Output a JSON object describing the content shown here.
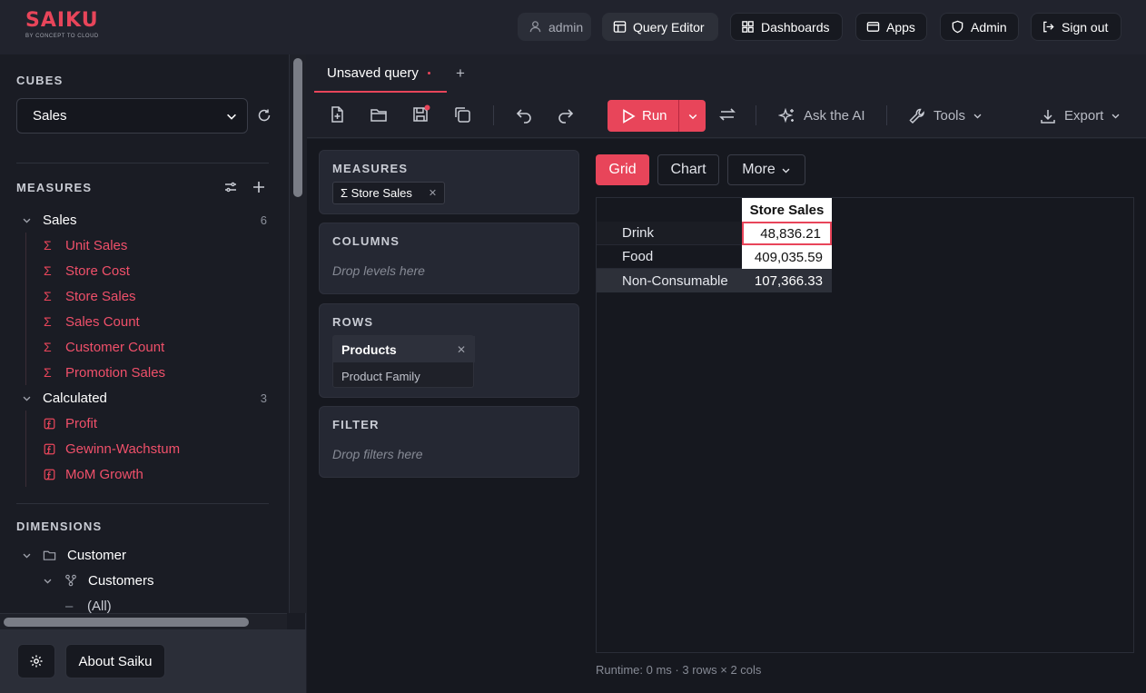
{
  "brand": {
    "logo": "SAIKU",
    "tagline": "BY CONCEPT TO CLOUD",
    "accent": "#e8455a"
  },
  "nav": {
    "user": "admin",
    "query_editor": "Query Editor",
    "dashboards": "Dashboards",
    "apps": "Apps",
    "admin": "Admin",
    "sign_out": "Sign out"
  },
  "sidebar": {
    "cubes_title": "CUBES",
    "cube_selected": "Sales",
    "measures_title": "MEASURES",
    "groups": [
      {
        "label": "Sales",
        "count": "6",
        "items": [
          "Unit Sales",
          "Store Cost",
          "Store Sales",
          "Sales Count",
          "Customer Count",
          "Promotion Sales"
        ]
      },
      {
        "label": "Calculated",
        "count": "3",
        "items": [
          "Profit",
          "Gewinn-Wachstum",
          "MoM Growth"
        ]
      }
    ],
    "dimensions_title": "DIMENSIONS",
    "dimensions": {
      "customer": "Customer",
      "customers": "Customers",
      "all": "(All)"
    },
    "about": "About Saiku"
  },
  "tabs": [
    {
      "label": "Unsaved query",
      "modified": true
    }
  ],
  "toolbar": {
    "run": "Run",
    "ask_ai": "Ask the AI",
    "tools": "Tools",
    "export": "Export"
  },
  "query": {
    "measures_title": "MEASURES",
    "measure_chip": "Σ Store Sales",
    "columns_title": "COLUMNS",
    "columns_hint": "Drop levels here",
    "rows_title": "ROWS",
    "row_dimension": "Products",
    "row_level": "Product Family",
    "filter_title": "FILTER",
    "filter_hint": "Drop filters here"
  },
  "view": {
    "grid": "Grid",
    "chart": "Chart",
    "more": "More"
  },
  "grid": {
    "column_header": "Store Sales",
    "rows": [
      {
        "label": "Drink",
        "value": "48,836.21",
        "selected": true
      },
      {
        "label": "Food",
        "value": "409,035.59",
        "selected": false
      },
      {
        "label": "Non-Consumable",
        "value": "107,366.33",
        "selected": false
      }
    ]
  },
  "status": {
    "runtime": "Runtime: 0 ms · 3 rows × 2 cols"
  }
}
